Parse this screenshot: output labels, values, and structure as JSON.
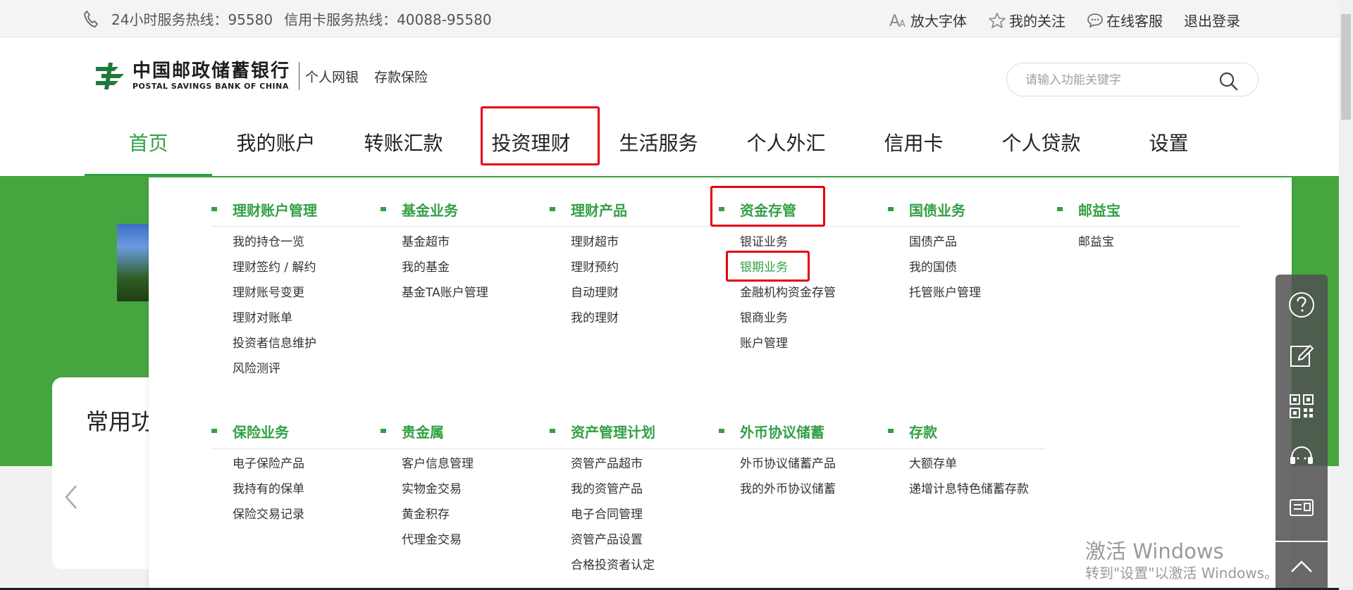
{
  "topbar": {
    "hotline_label": "24小时服务热线：95580",
    "card_hotline_label": "信用卡服务热线：40088-95580",
    "links": [
      {
        "name": "enlarge-font-link",
        "label": "放大字体",
        "icon": "font-size-icon"
      },
      {
        "name": "my-follow-link",
        "label": "我的关注",
        "icon": "star-icon"
      },
      {
        "name": "online-service-link",
        "label": "在线客服",
        "icon": "chat-icon"
      },
      {
        "name": "logout-link",
        "label": "退出登录",
        "icon": ""
      }
    ]
  },
  "header": {
    "bank_name_cn": "中国邮政储蓄银行",
    "bank_name_en": "POSTAL SAVINGS BANK OF CHINA",
    "channel": "个人网银",
    "deposit_insurance": "存款保险",
    "search": {
      "placeholder": "请输入功能关键字"
    }
  },
  "nav": {
    "items": [
      "首页",
      "我的账户",
      "转账汇款",
      "投资理财",
      "生活服务",
      "个人外汇",
      "信用卡",
      "个人贷款",
      "设置"
    ],
    "active": "首页",
    "highlighted": "投资理财"
  },
  "card": {
    "title": "常用功"
  },
  "menu": {
    "row1": [
      {
        "title": "理财账户管理",
        "links": [
          "我的持仓一览",
          "理财签约 / 解约",
          "理财账号变更",
          "理财对账单",
          "投资者信息维护",
          "风险测评"
        ]
      },
      {
        "title": "基金业务",
        "links": [
          "基金超市",
          "我的基金",
          "基金TA账户管理"
        ]
      },
      {
        "title": "理财产品",
        "links": [
          "理财超市",
          "理财预约",
          "自动理财",
          "我的理财"
        ]
      },
      {
        "title": "资金存管",
        "links": [
          "银证业务",
          "银期业务",
          "金融机构资金存管",
          "银商业务",
          "账户管理"
        ]
      },
      {
        "title": "国债业务",
        "links": [
          "国债产品",
          "我的国债",
          "托管账户管理"
        ]
      },
      {
        "title": "邮益宝",
        "links": [
          "邮益宝"
        ]
      }
    ],
    "row2": [
      {
        "title": "保险业务",
        "links": [
          "电子保险产品",
          "我持有的保单",
          "保险交易记录"
        ]
      },
      {
        "title": "贵金属",
        "links": [
          "客户信息管理",
          "实物金交易",
          "黄金积存",
          "代理金交易"
        ]
      },
      {
        "title": "资产管理计划",
        "links": [
          "资管产品超市",
          "我的资管产品",
          "电子合同管理",
          "资管产品设置",
          "合格投资者认定"
        ]
      },
      {
        "title": "外币协议储蓄",
        "links": [
          "外币协议储蓄产品",
          "我的外币协议储蓄"
        ]
      },
      {
        "title": "存款",
        "links": [
          "大额存单",
          "递增计息特色储蓄存款"
        ]
      }
    ],
    "selected_link": "银期业务",
    "highlighted_title": "资金存管"
  },
  "watermark": {
    "line1": "激活 Windows",
    "line2": "转到\"设置\"以激活 Windows。"
  },
  "colors": {
    "brand_green": "#33a045",
    "banner_green": "#45a53f",
    "highlight_red": "#e60012"
  }
}
